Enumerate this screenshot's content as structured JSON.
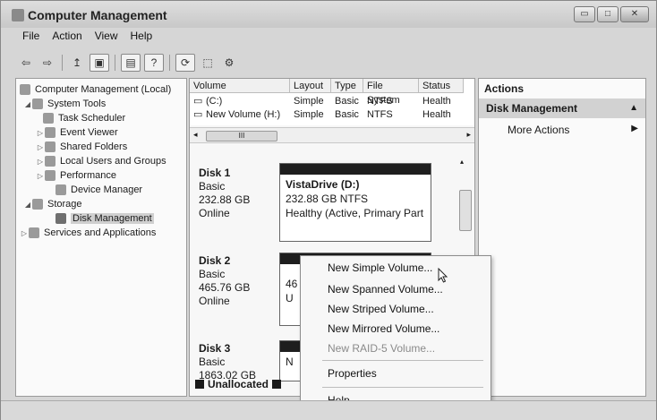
{
  "window": {
    "title": "Computer Management",
    "controls": [
      "▭",
      "□",
      "✕"
    ]
  },
  "menu": [
    {
      "label": "File",
      "accel": "F"
    },
    {
      "label": "Action",
      "accel": "A"
    },
    {
      "label": "View",
      "accel": "V"
    },
    {
      "label": "Help",
      "accel": "H"
    }
  ],
  "toolbar": {
    "icons": [
      "back-arrow",
      "forward-arrow",
      "up-level",
      "show-hide-tree",
      "properties",
      "help",
      "refresh",
      "export",
      "settings"
    ]
  },
  "tree": {
    "root": "Computer Management (Local)",
    "items": [
      {
        "label": "System Tools",
        "expanded": true
      },
      {
        "label": "Task Scheduler"
      },
      {
        "label": "Event Viewer"
      },
      {
        "label": "Shared Folders"
      },
      {
        "label": "Local Users and Groups"
      },
      {
        "label": "Performance"
      },
      {
        "label": "Device Manager"
      },
      {
        "label": "Storage",
        "expanded": true
      },
      {
        "label": "Disk Management",
        "selected": true
      },
      {
        "label": "Services and Applications"
      }
    ]
  },
  "volumes": {
    "headers": [
      "Volume",
      "Layout",
      "Type",
      "File System",
      "Status"
    ],
    "rows": [
      {
        "volume": "(C:)",
        "layout": "Simple",
        "type": "Basic",
        "fs": "NTFS",
        "status": "Health"
      },
      {
        "volume": "New Volume (H:)",
        "layout": "Simple",
        "type": "Basic",
        "fs": "NTFS",
        "status": "Health"
      }
    ],
    "scroll_thumb": "III"
  },
  "disks": [
    {
      "name": "Disk 1",
      "type": "Basic",
      "size": "232.88 GB",
      "state": "Online",
      "volume": {
        "label": "VistaDrive (D:)",
        "size_fs": "232.88 GB NTFS",
        "status": "Healthy (Active, Primary Part"
      }
    },
    {
      "name": "Disk 2",
      "type": "Basic",
      "size": "465.76 GB",
      "state": "Online",
      "volume": {
        "label": "",
        "size_fs": "46",
        "status": "U"
      }
    },
    {
      "name": "Disk 3",
      "type": "Basic",
      "size": "1863.02 GB",
      "state": "",
      "volume": {
        "label": "N",
        "size_fs": "",
        "status": ""
      }
    }
  ],
  "unallocated_label": "Unallocated",
  "actions": {
    "title": "Actions",
    "section": "Disk Management",
    "more": "More Actions"
  },
  "context_menu": {
    "items": [
      {
        "label": "New Simple Volume...",
        "enabled": true
      },
      {
        "label": "New Spanned Volume...",
        "enabled": true
      },
      {
        "label": "New Striped Volume...",
        "enabled": true
      },
      {
        "label": "New Mirrored Volume...",
        "enabled": true
      },
      {
        "label": "New RAID-5 Volume...",
        "enabled": false
      },
      {
        "label": "Properties",
        "enabled": true
      },
      {
        "label": "Help",
        "enabled": true
      }
    ]
  }
}
